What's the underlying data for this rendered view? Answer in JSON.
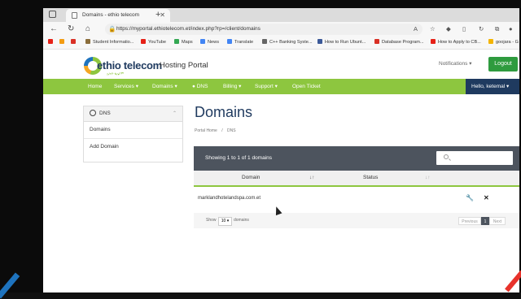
{
  "browser": {
    "tab_title": "Domains - ethio telecom",
    "url": "https://myportal.ethiotelecom.et/index.php?rp=/client/domains",
    "bookmarks": [
      "Student Informatio...",
      "YouTube",
      "Maps",
      "News",
      "Translate",
      "C++ Banking Syste...",
      "How to Run Ubunt...",
      "Database Program...",
      "How to Apply to CB...",
      "goojara - G"
    ]
  },
  "header": {
    "logo_text": "ethio telecom",
    "logo_tagline": "ኢትዮ ቴሌኮም",
    "portal_title": "Hosting Portal",
    "notifications_label": "Notifications ▾",
    "logout_label": "Logout"
  },
  "nav": {
    "items": [
      "Home",
      "Services ▾",
      "Domains ▾",
      "DNS",
      "Billing ▾",
      "Support ▾",
      "Open Ticket"
    ],
    "user_label": "Hello, ketemal ▾"
  },
  "sidebar": {
    "title": "DNS",
    "items": [
      "Domains",
      "Add Domain"
    ]
  },
  "main": {
    "title": "Domains",
    "breadcrumb": [
      "Portal Home",
      "/",
      "DNS"
    ],
    "showing": "Showing 1 to 1 of 1 domains",
    "columns": [
      "Domain",
      "Status"
    ],
    "rows": [
      {
        "domain": "marklandhotelandspa.com.et",
        "status": ""
      }
    ],
    "footer": {
      "show_label": "Show",
      "page_size": "10 ▾",
      "domains_label": "domains",
      "prev": "Previous",
      "page": "1",
      "next": "Next"
    }
  },
  "colors": {
    "green": "#8dc63f",
    "navy": "#1f3a5f",
    "table_bar": "#4d545e",
    "logout": "#2e9b3e"
  }
}
